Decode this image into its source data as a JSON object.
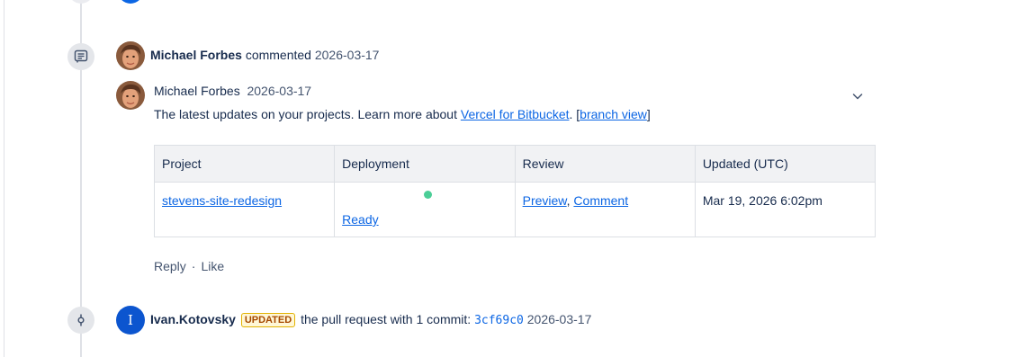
{
  "comment_event": {
    "author": "Michael Forbes",
    "verb": "commented",
    "date": "2026-03-17",
    "comment": {
      "author": "Michael Forbes",
      "date": "2026-03-17",
      "text_before": "The latest updates on your projects. Learn more about ",
      "link_text": "Vercel for Bitbucket",
      "text_mid": ". [",
      "branch_link": "branch view",
      "text_after": "]"
    },
    "table": {
      "headers": [
        "Project",
        "Deployment",
        "Review",
        "Updated (UTC)"
      ],
      "row": {
        "project": "stevens-site-redesign",
        "deployment": "Ready",
        "review_preview": "Preview",
        "review_sep": ", ",
        "review_comment": "Comment",
        "updated": "Mar 19, 2026 6:02pm"
      }
    },
    "actions": {
      "reply": "Reply",
      "sep": "·",
      "like": "Like"
    }
  },
  "update_event": {
    "avatar_letter": "I",
    "author": "Ivan.Kotovsky",
    "badge": "UPDATED",
    "text": " the pull request with 1 commit: ",
    "commit": "3cf69c0",
    "date": "2026-03-17"
  },
  "icons": {
    "comment_event_icon": "comment-icon",
    "commit_event_icon": "commit-icon",
    "expand_icon": "chevron-down-icon"
  },
  "colors": {
    "link": "#0c66e4",
    "status_ready": "#4bce97",
    "avatar_blue": "#0c55cf",
    "badge_border": "#e2b203"
  }
}
